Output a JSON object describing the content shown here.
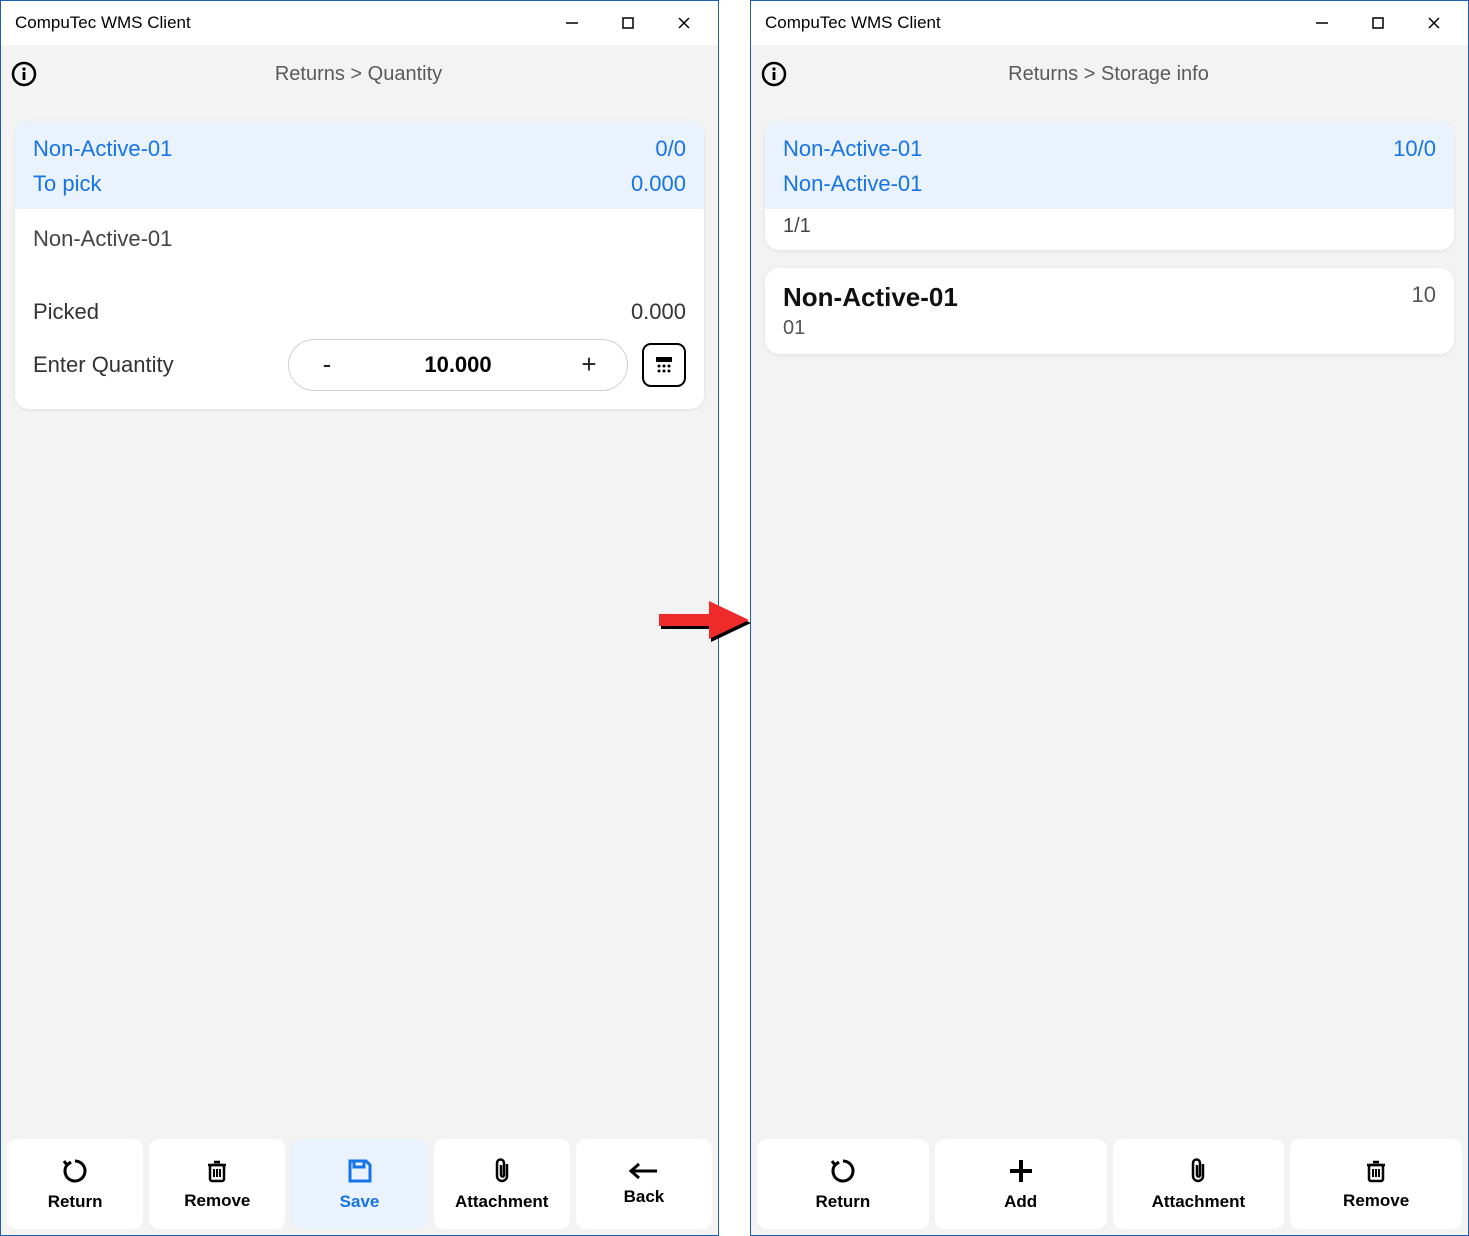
{
  "app_title": "CompuTec WMS Client",
  "left": {
    "breadcrumb": "Returns > Quantity",
    "hl": {
      "line1_left": "Non-Active-01",
      "line1_right": "0/0",
      "line2_left": "To pick",
      "line2_right": "0.000"
    },
    "body": {
      "storage": "Non-Active-01",
      "picked_label": "Picked",
      "picked_value": "0.000",
      "enter_qty_label": "Enter Quantity",
      "qty_value": "10.000"
    },
    "buttons": {
      "return": "Return",
      "remove": "Remove",
      "save": "Save",
      "attachment": "Attachment",
      "back": "Back"
    }
  },
  "right": {
    "breadcrumb": "Returns > Storage info",
    "hl": {
      "line1_left": "Non-Active-01",
      "line1_right": "10/0",
      "line2_left": "Non-Active-01"
    },
    "sub_count": "1/1",
    "item": {
      "name": "Non-Active-01",
      "qty": "10",
      "sub": "01"
    },
    "buttons": {
      "return": "Return",
      "add": "Add",
      "attachment": "Attachment",
      "remove": "Remove"
    }
  }
}
